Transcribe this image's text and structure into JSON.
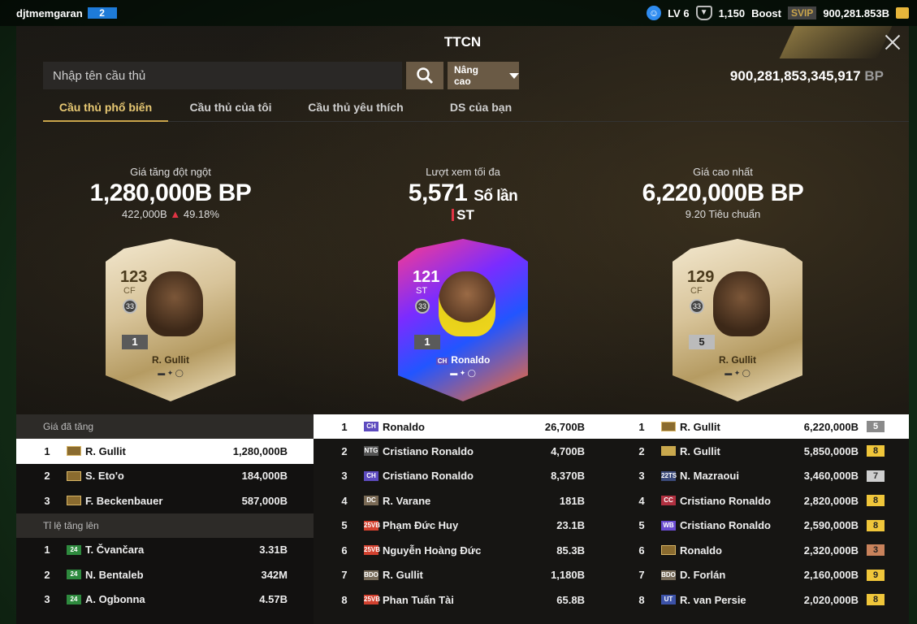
{
  "topbar": {
    "username": "djtmemgaran",
    "user_level": "2",
    "lv_label": "LV 6",
    "trophy_count": "1,150",
    "boost_label": "Boost",
    "svip_label": "SVIP",
    "coins": "900,281.853B"
  },
  "panel": {
    "title": "TTCN",
    "search_placeholder": "Nhập tên cầu thủ",
    "advanced_label": "Nâng cao",
    "balance_value": "900,281,853,345,917",
    "balance_unit": "BP",
    "tabs": [
      "Cầu thủ phổ biến",
      "Cầu thủ của tôi",
      "Cầu thủ yêu thích",
      "DS của bạn"
    ]
  },
  "featured": {
    "left": {
      "label": "Giá tăng đột ngột",
      "value": "1,280,000B BP",
      "sub_price": "422,000B",
      "sub_percent": "49.18%",
      "card": {
        "ovr": "123",
        "pos": "CF",
        "badge": "33",
        "grade": "1",
        "name": "R. Gullit"
      }
    },
    "middle": {
      "label": "Lượt xem tối đa",
      "value": "5,571",
      "unit": "Số lần",
      "position": "ST",
      "card": {
        "ovr": "121",
        "pos": "ST",
        "badge": "33",
        "grade": "1",
        "name": "Ronaldo",
        "season": "CH"
      }
    },
    "right": {
      "label": "Giá cao nhất",
      "value": "6,220,000B BP",
      "sub": "9.20 Tiêu chuẩn",
      "card": {
        "ovr": "129",
        "pos": "CF",
        "badge": "33",
        "grade": "5",
        "name": "R. Gullit"
      }
    }
  },
  "left_table": {
    "header1": "Giá đã tăng",
    "rows1": [
      {
        "rank": "1",
        "name": "R. Gullit",
        "value": "1,280,000B"
      },
      {
        "rank": "2",
        "name": "S. Eto'o",
        "value": "184,000B"
      },
      {
        "rank": "3",
        "name": "F. Beckenbauer",
        "value": "587,000B"
      }
    ],
    "header2": "Tỉ lệ tăng lên",
    "rows2": [
      {
        "rank": "1",
        "season": "24",
        "name": "T. Čvančara",
        "value": "3.31B"
      },
      {
        "rank": "2",
        "season": "24",
        "name": "N. Bentaleb",
        "value": "342M"
      },
      {
        "rank": "3",
        "season": "24",
        "name": "A. Ogbonna",
        "value": "4.57B"
      }
    ]
  },
  "mid_table": [
    {
      "rank": "1",
      "season": "CH",
      "name": "Ronaldo",
      "value": "26,700B"
    },
    {
      "rank": "2",
      "season": "NTG",
      "name": "Cristiano Ronaldo",
      "value": "4,700B"
    },
    {
      "rank": "3",
      "season": "CH",
      "name": "Cristiano Ronaldo",
      "value": "8,370B"
    },
    {
      "rank": "4",
      "season": "DC",
      "name": "R. Varane",
      "value": "181B"
    },
    {
      "rank": "5",
      "season": "25VB",
      "name": "Phạm Đức Huy",
      "value": "23.1B"
    },
    {
      "rank": "6",
      "season": "25VB",
      "name": "Nguyễn Hoàng Đức",
      "value": "85.3B"
    },
    {
      "rank": "7",
      "season": "BDO",
      "name": "R. Gullit",
      "value": "1,180B"
    },
    {
      "rank": "8",
      "season": "25VB",
      "name": "Phan Tuấn Tài",
      "value": "65.8B"
    }
  ],
  "right_table": [
    {
      "rank": "1",
      "season": "",
      "name": "R. Gullit",
      "value": "6,220,000B",
      "level": "5"
    },
    {
      "rank": "2",
      "season": "",
      "name": "R. Gullit",
      "value": "5,850,000B",
      "level": "8"
    },
    {
      "rank": "3",
      "season": "22TS",
      "name": "N. Mazraoui",
      "value": "3,460,000B",
      "level": "7"
    },
    {
      "rank": "4",
      "season": "CC",
      "name": "Cristiano Ronaldo",
      "value": "2,820,000B",
      "level": "8"
    },
    {
      "rank": "5",
      "season": "WB",
      "name": "Cristiano Ronaldo",
      "value": "2,590,000B",
      "level": "8"
    },
    {
      "rank": "6",
      "season": "",
      "name": "Ronaldo",
      "value": "2,320,000B",
      "level": "3"
    },
    {
      "rank": "7",
      "season": "BDO",
      "name": "D. Forlán",
      "value": "2,160,000B",
      "level": "9"
    },
    {
      "rank": "8",
      "season": "UT",
      "name": "R. van Persie",
      "value": "2,020,000B",
      "level": "8"
    }
  ],
  "colors": {
    "accent_gold": "#c9a44b",
    "up_red": "#e03444",
    "level_gold": "#f0c63a",
    "level_silver": "#cfcfcf",
    "level_bronze": "#c9825b"
  }
}
